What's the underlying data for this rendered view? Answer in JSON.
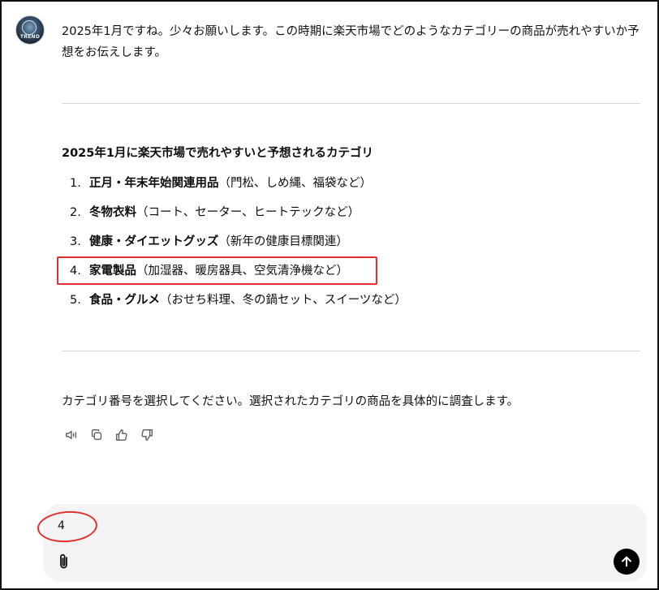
{
  "assistant": {
    "avatar_label": "TREND",
    "intro": "2025年1月ですね。少々お願いします。この時期に楽天市場でどのようなカテゴリーの商品が売れやすいか予想をお伝えします。",
    "heading": "2025年1月に楽天市場で売れやすいと予想されるカテゴリ",
    "categories": [
      {
        "num": "1.",
        "name": "正月・年末年始関連用品",
        "detail": "（門松、しめ縄、福袋など）"
      },
      {
        "num": "2.",
        "name": "冬物衣料",
        "detail": "（コート、セーター、ヒートテックなど）"
      },
      {
        "num": "3.",
        "name": "健康・ダイエットグッズ",
        "detail": "（新年の健康目標関連）"
      },
      {
        "num": "4.",
        "name": "家電製品",
        "detail": "（加湿器、暖房器具、空気清浄機など）"
      },
      {
        "num": "5.",
        "name": "食品・グルメ",
        "detail": "（おせち料理、冬の鍋セット、スイーツなど）"
      }
    ],
    "prompt": "カテゴリ番号を選択してください。選択されたカテゴリの商品を具体的に調査します。"
  },
  "actions": [
    {
      "icon": "speaker-icon"
    },
    {
      "icon": "copy-icon"
    },
    {
      "icon": "thumbs-up-icon"
    },
    {
      "icon": "thumbs-down-icon"
    }
  ],
  "composer": {
    "value": "4",
    "attach_icon": "paperclip-icon",
    "send_icon": "arrow-up-icon"
  },
  "colors": {
    "annotation": "#e0302f",
    "send_button": "#000000",
    "composer_bg": "#f4f4f4",
    "divider": "#d9d9d9"
  }
}
